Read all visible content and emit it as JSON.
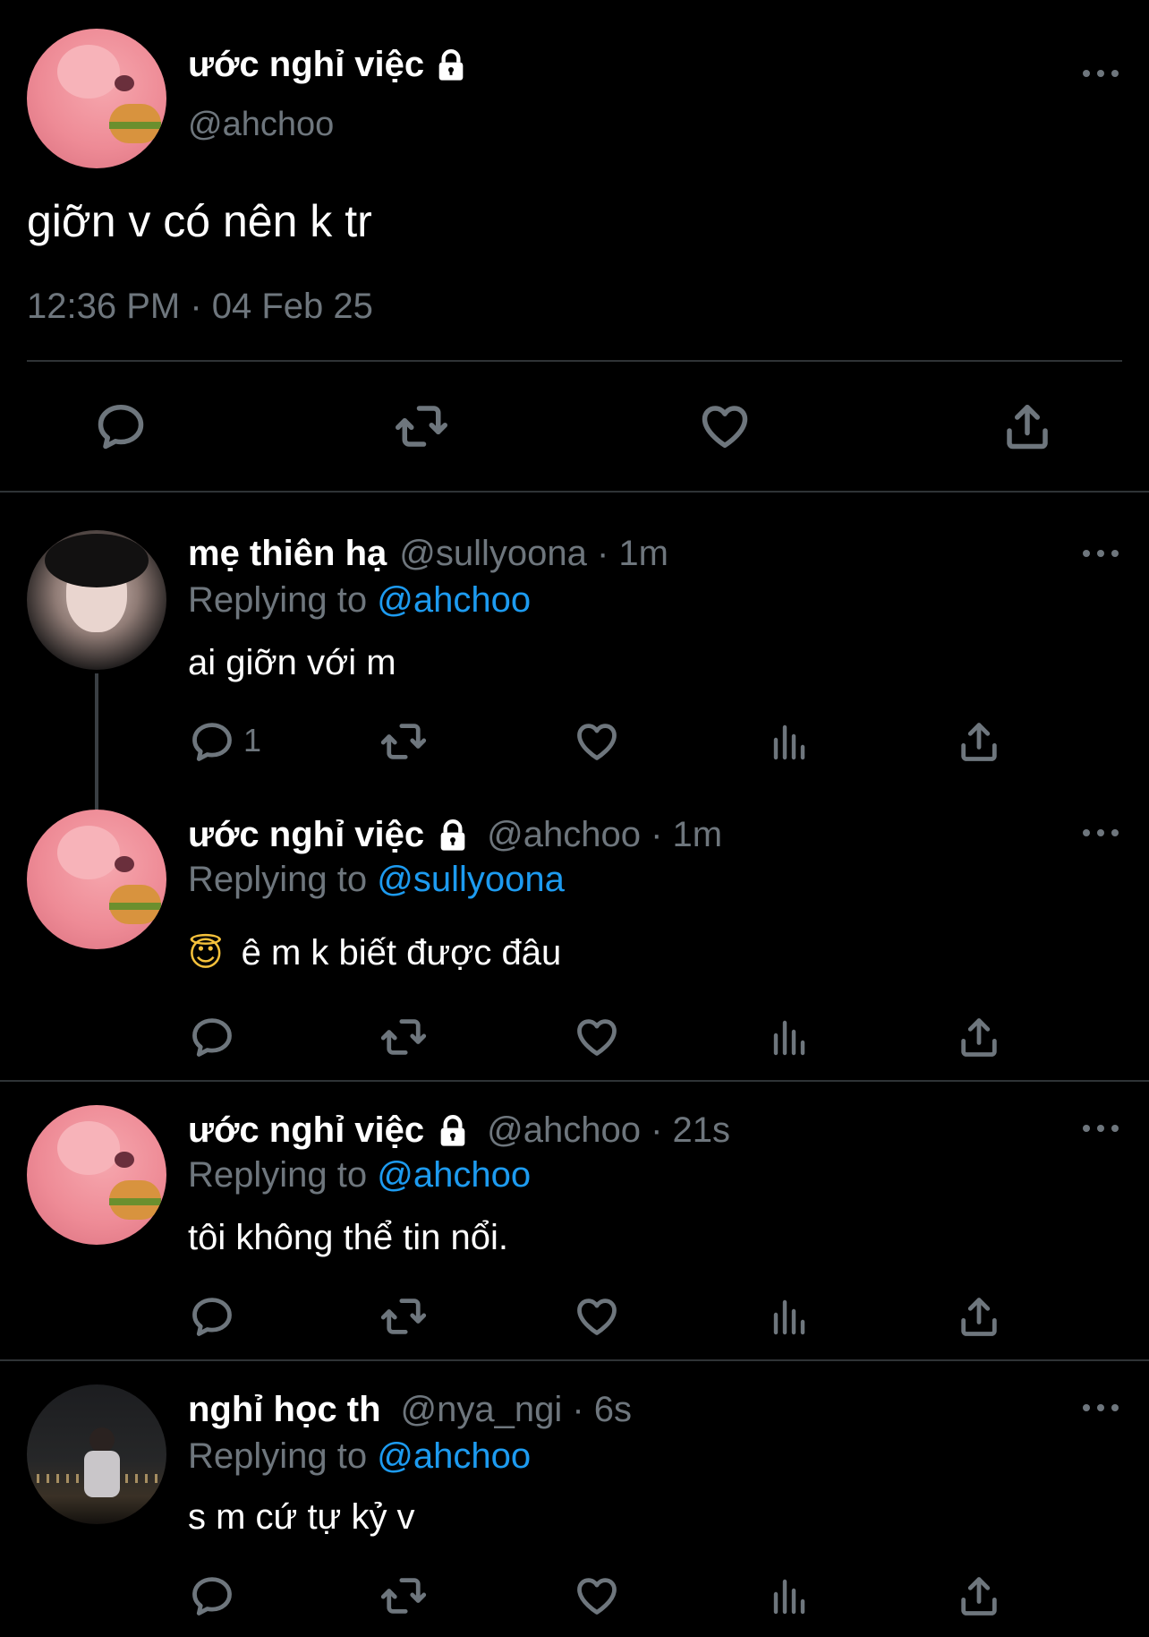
{
  "main_tweet": {
    "name": "ước nghỉ việc",
    "handle": "@ahchoo",
    "text": "giỡn v có nên k tr",
    "timestamp": "12:36 PM · 04 Feb 25"
  },
  "replies": [
    {
      "name": "mẹ thiên hạ",
      "meta": "@sullyoona · 1m",
      "replying_prefix": "Replying to",
      "replying_to": "@ahchoo",
      "text": "ai giỡn với m",
      "reply_count": "1",
      "locked": false
    },
    {
      "name": "ước nghỉ việc",
      "meta": "@ahchoo · 1m",
      "replying_prefix": "Replying to",
      "replying_to": "@sullyoona",
      "emoji": "😇",
      "text": "ê m k biết được đâu",
      "reply_count": "",
      "locked": true
    },
    {
      "name": "ước nghỉ việc",
      "meta": "@ahchoo · 21s",
      "replying_prefix": "Replying to",
      "replying_to": "@ahchoo",
      "text": "tôi không thể tin nổi.",
      "reply_count": "",
      "locked": true
    },
    {
      "name": "nghỉ học th",
      "meta": "@nya_ngi · 6s",
      "replying_prefix": "Replying to",
      "replying_to": "@ahchoo",
      "text": "s m cứ tự kỷ v",
      "reply_count": "",
      "locked": false
    }
  ],
  "icons": {
    "reply": "reply-icon",
    "retweet": "retweet-icon",
    "like": "heart-icon",
    "views": "views-icon",
    "share": "share-icon",
    "more": "more-icon",
    "lock": "lock-icon"
  },
  "colors": {
    "background": "#000000",
    "text": "#ffffff",
    "muted": "#6e767d",
    "link": "#1d9bf0",
    "divider": "#2f3336"
  }
}
